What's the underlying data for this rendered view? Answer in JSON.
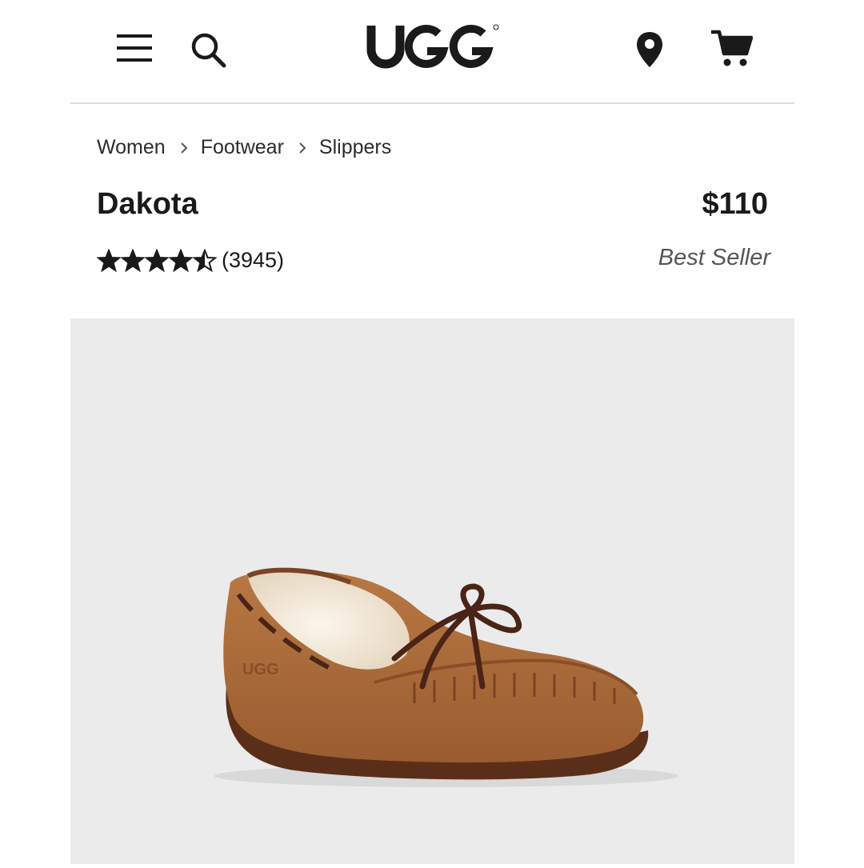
{
  "header": {
    "brand": "UGG",
    "icons": [
      "menu-icon",
      "search-icon",
      "location-pin-icon",
      "cart-icon"
    ]
  },
  "breadcrumb": [
    {
      "label": "Women"
    },
    {
      "label": "Footwear"
    },
    {
      "label": "Slippers"
    }
  ],
  "product": {
    "name": "Dakota",
    "price": "$110",
    "rating": 4.5,
    "rating_max": 5,
    "review_count": "(3945)",
    "badge": "Best Seller",
    "image_logo": "UGG"
  },
  "colors": {
    "text": "#1a1a1a",
    "image_background": "#ebebeb",
    "slipper": "#b06d3e",
    "lace": "#4a2416",
    "shearling": "#f3ece0"
  }
}
